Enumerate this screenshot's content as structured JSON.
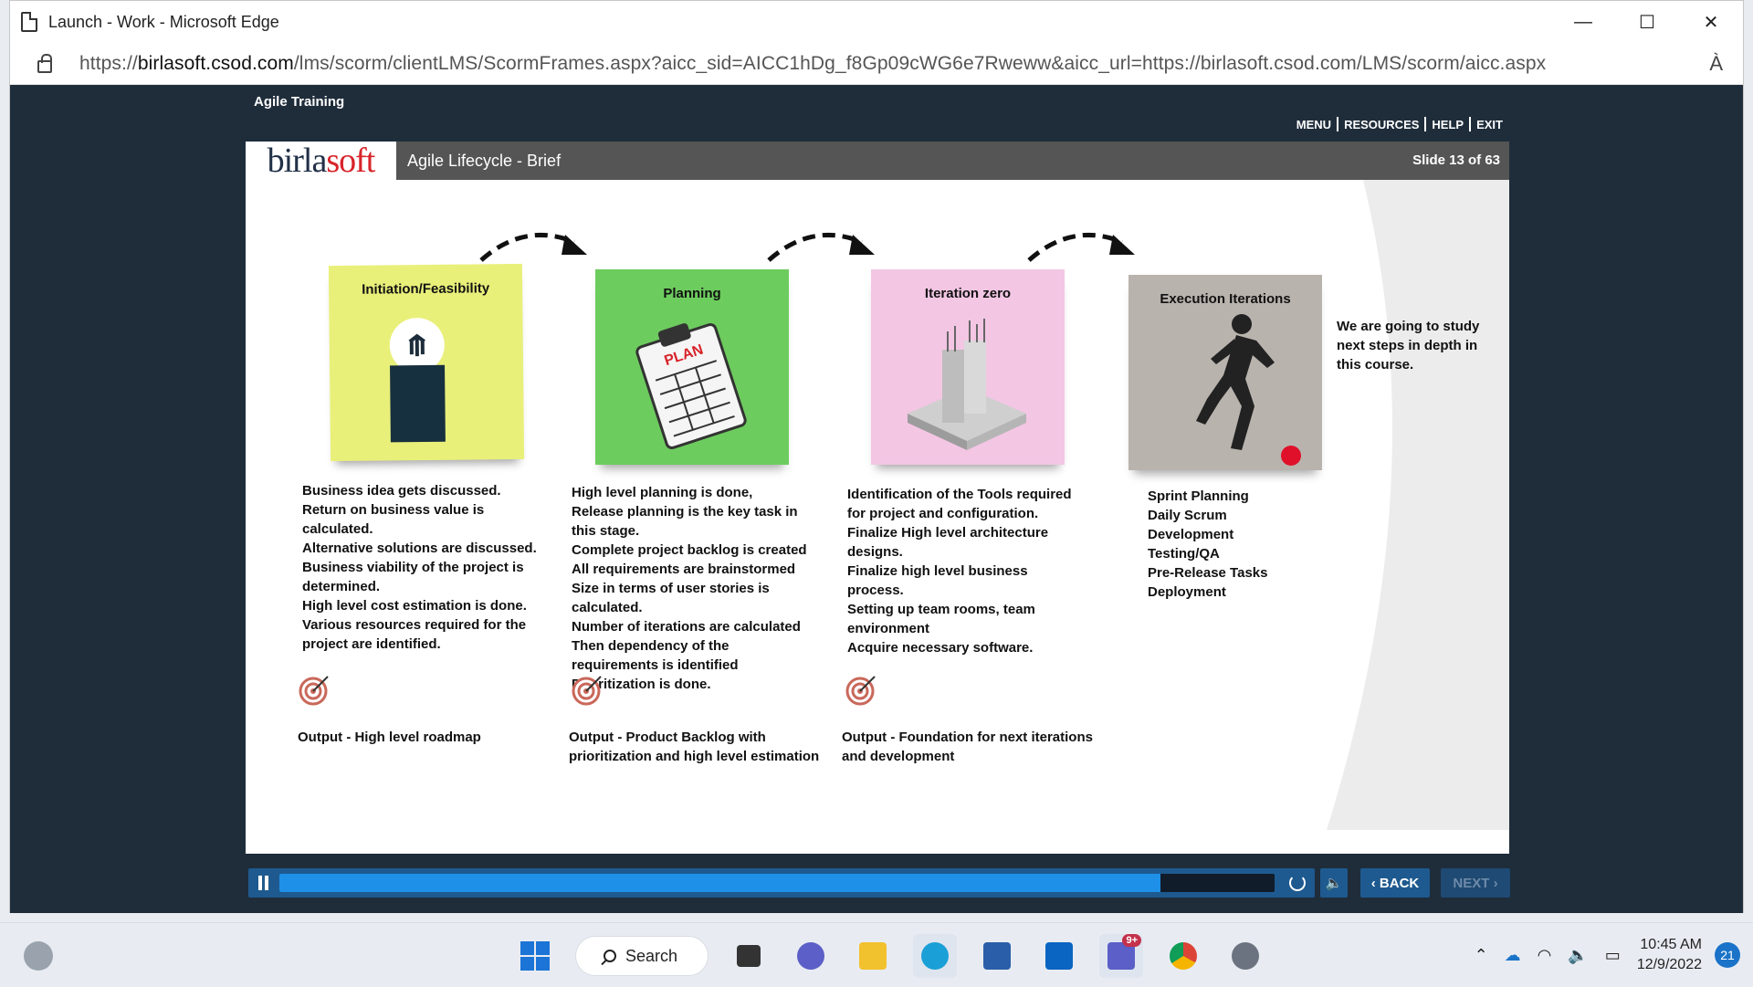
{
  "browser": {
    "title": "Launch - Work - Microsoft Edge",
    "url_prefix": "https://",
    "url_host": "birlasoft.csod.com",
    "url_path": "/lms/scorm/clientLMS/ScormFrames.aspx?aicc_sid=AICC1hDg_f8Gp09cWG6e7Rweww&aicc_url=https://birlasoft.csod.com/LMS/scorm/aicc.aspx",
    "minimize": "—",
    "maximize": "☐",
    "close": "✕",
    "read_aloud": "À"
  },
  "lms": {
    "course_title": "Agile Training",
    "links": [
      "MENU",
      "RESOURCES",
      "HELP",
      "EXIT"
    ]
  },
  "slide": {
    "logo_main": "birla",
    "logo_accent": "soft",
    "title": "Agile Lifecycle - Brief",
    "counter": "Slide 13 of 63",
    "note": "We are going to study next steps in depth in this course.",
    "phases": [
      {
        "title": "Initiation/Feasibility",
        "color": "#e9f07a",
        "icon": "lightbulb-icon",
        "steps": [
          "Business idea gets discussed.",
          "Return on business value is",
          "calculated.",
          "Alternative solutions are discussed.",
          "Business viability of the project is",
          "determined.",
          "High level cost estimation is done.",
          "Various resources required for the",
          "project are identified."
        ],
        "output": [
          "Output - High level roadmap"
        ]
      },
      {
        "title": "Planning",
        "color": "#6dcc5e",
        "icon": "clipboard-plan-icon",
        "icon_text": "PLAN",
        "steps": [
          "High level planning is done,",
          "Release planning is the key task in",
          "this stage.",
          "Complete project backlog is created",
          "All requirements are brainstormed",
          "Size in terms of user stories is",
          "calculated.",
          "Number of iterations are calculated",
          "Then dependency of the",
          "requirements is identified",
          "Prioritization is done."
        ],
        "output": [
          "Output - Product Backlog with",
          "prioritization and high level estimation"
        ]
      },
      {
        "title": "Iteration zero",
        "color": "#f3c6e4",
        "icon": "foundation-pillars-icon",
        "steps": [
          "Identification of the Tools required",
          "for project and configuration.",
          "Finalize High level architecture",
          "designs.",
          "Finalize high level business",
          "process.",
          "Setting up team rooms, team",
          "environment",
          "Acquire necessary software."
        ],
        "output": [
          "Output - Foundation for next iterations",
          "and development"
        ]
      },
      {
        "title": "Execution Iterations",
        "color": "#b9b3ae",
        "icon": "runner-icon",
        "steps": [
          "Sprint Planning",
          "Daily Scrum",
          "Development",
          "Testing/QA",
          "Pre-Release Tasks",
          "Deployment"
        ],
        "output": []
      }
    ]
  },
  "player": {
    "progress": 0.885,
    "back_label": "‹ BACK",
    "next_label": "NEXT ›",
    "volume_icon": "🔈"
  },
  "taskbar": {
    "search_label": "Search",
    "teams_badge": "9+",
    "time": "10:45 AM",
    "date": "12/9/2022",
    "notifications": "21"
  }
}
